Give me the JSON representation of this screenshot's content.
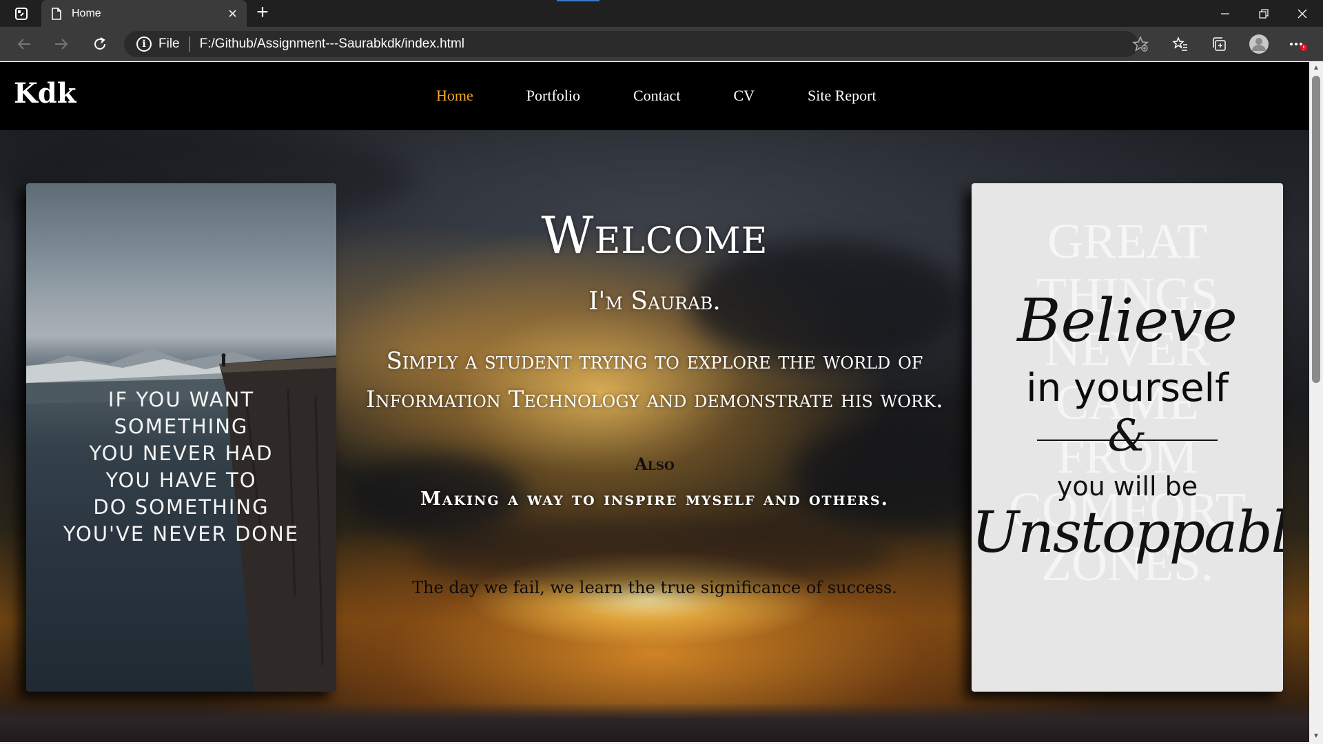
{
  "browser": {
    "tab_title": "Home",
    "tab_close": "×",
    "new_tab": "+",
    "address": {
      "scheme_label": "File",
      "url": "F:/Github/Assignment---Saurabkdk/index.html",
      "info_glyph": "i"
    },
    "icons": [
      "tab-actions-icon",
      "page-icon",
      "back-icon",
      "forward-icon",
      "refresh-icon",
      "favorite-add-icon",
      "favorites-icon",
      "collections-icon",
      "profile-icon",
      "more-icon",
      "minimize-icon",
      "restore-icon",
      "close-window-icon"
    ],
    "notification_badge_color": "#e81123"
  },
  "site": {
    "logo": "Kdk",
    "nav": [
      {
        "label": "Home",
        "active": true
      },
      {
        "label": "Portfolio",
        "active": false
      },
      {
        "label": "Contact",
        "active": false
      },
      {
        "label": "CV",
        "active": false
      },
      {
        "label": "Site Report",
        "active": false
      }
    ],
    "active_color": "#f5a623"
  },
  "hero": {
    "welcome": "Welcome",
    "name": "I'm Saurab.",
    "description": "Simply a student trying to explore the world of Information Technology and demonstrate his work.",
    "also": "Also",
    "inspire": "Making a way to inspire myself and others.",
    "quote": "The day we fail, we learn the true significance of success."
  },
  "left_poster": {
    "lines": [
      "IF YOU WANT",
      "SOMETHING",
      "YOU NEVER HAD",
      "YOU HAVE TO",
      "DO SOMETHING",
      "YOU'VE NEVER DONE"
    ]
  },
  "right_poster": {
    "background_lines": [
      "GREAT",
      "THINGS",
      "NEVER",
      "CAME",
      "FROM",
      "COMFORT",
      "ZONES."
    ],
    "believe": "Believe",
    "in_yourself": "in yourself",
    "amp": "&",
    "you_will_be": "you will be",
    "unstoppable": "Unstoppable"
  }
}
